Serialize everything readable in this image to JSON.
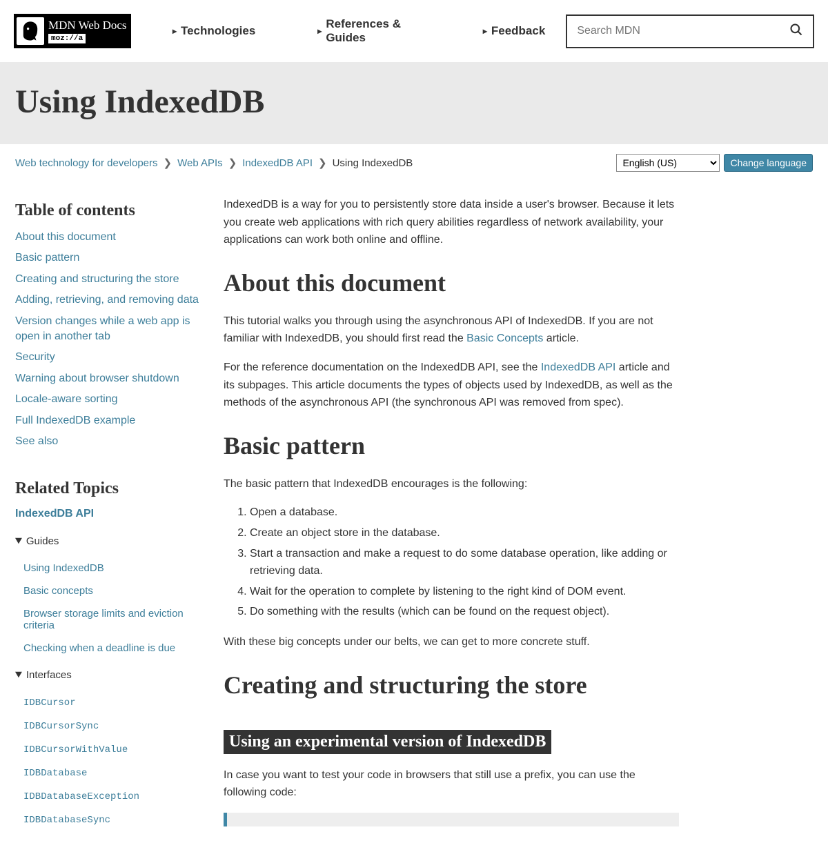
{
  "logo": {
    "main": "MDN Web Docs",
    "sub": "moz://a"
  },
  "nav": {
    "tech": "Technologies",
    "refs": "References & Guides",
    "feedback": "Feedback"
  },
  "search": {
    "placeholder": "Search MDN"
  },
  "title": "Using IndexedDB",
  "breadcrumb": {
    "a": "Web technology for developers",
    "b": "Web APIs",
    "c": "IndexedDB API",
    "d": "Using IndexedDB"
  },
  "lang": {
    "selected": "English (US)",
    "button": "Change language"
  },
  "toc_title": "Table of contents",
  "toc": [
    "About this document",
    "Basic pattern",
    "Creating and structuring the store",
    "Adding, retrieving, and removing data",
    "Version changes while a web app is open in another tab",
    "Security",
    "Warning about browser shutdown",
    "Locale-aware sorting",
    "Full IndexedDB example",
    "See also"
  ],
  "related_title": "Related Topics",
  "related_main": "IndexedDB API",
  "guides_label": "Guides",
  "guides": [
    "Using IndexedDB",
    "Basic concepts",
    "Browser storage limits and eviction criteria",
    "Checking when a deadline is due"
  ],
  "interfaces_label": "Interfaces",
  "interfaces": [
    "IDBCursor",
    "IDBCursorSync",
    "IDBCursorWithValue",
    "IDBDatabase",
    "IDBDatabaseException",
    "IDBDatabaseSync"
  ],
  "article": {
    "intro": "IndexedDB is a way for you to persistently store data inside a user's browser. Because it lets you create web applications with rich query abilities regardless of network availability, your applications can work both online and offline.",
    "h_about": "About this document",
    "about_p1a": "This tutorial walks you through using the asynchronous API of IndexedDB. If you are not familiar with IndexedDB, you should first read the ",
    "about_link1": "Basic Concepts",
    "about_p1b": " article.",
    "about_p2a": "For the reference documentation on the IndexedDB API, see the ",
    "about_link2": "IndexedDB API",
    "about_p2b": " article and its subpages. This article documents the types of objects used by IndexedDB, as well as the methods of the asynchronous API (the synchronous API was removed from spec).",
    "h_basic": "Basic pattern",
    "basic_intro": "The basic pattern that IndexedDB encourages is the following:",
    "steps": [
      "Open a database.",
      "Create an object store in the database.",
      "Start a transaction and make a request to do some database operation, like adding or retrieving data.",
      "Wait for the operation to complete by listening to the right kind of DOM event.",
      "Do something with the results (which can be found on the request object)."
    ],
    "basic_outro": "With these big concepts under our belts, we can get to more concrete stuff.",
    "h_creating": "Creating and structuring the store",
    "h_experimental": "Using an experimental version of IndexedDB",
    "experimental_p": "In case you want to test your code in browsers that still use a prefix, you can use the following code:"
  }
}
